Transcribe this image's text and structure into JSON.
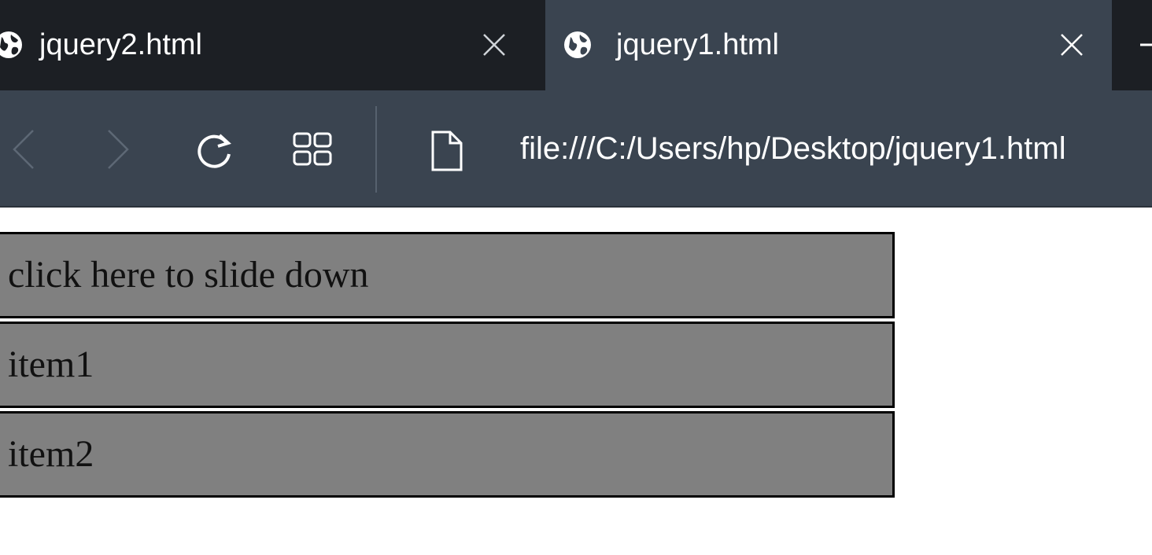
{
  "tabs": [
    {
      "title": "jquery2.html",
      "active": false,
      "icon": "globe-icon"
    },
    {
      "title": "jquery1.html",
      "active": true,
      "icon": "globe-icon"
    }
  ],
  "toolbar": {
    "back_icon": "chevron-left-icon",
    "forward_icon": "chevron-right-icon",
    "refresh_icon": "refresh-icon",
    "tabs_overview_icon": "grid-icon",
    "page_icon": "document-icon",
    "address": "file:///C:/Users/hp/Desktop/jquery1.html"
  },
  "page": {
    "flip_label": "click here to slide down",
    "panel_items": [
      "item1",
      "item2"
    ]
  },
  "colors": {
    "tabbar_bg": "#1c1f24",
    "active_tab_bg": "#3a4450",
    "toolbar_bg": "#3a4450",
    "block_bg": "#808080",
    "block_border": "#000000"
  }
}
